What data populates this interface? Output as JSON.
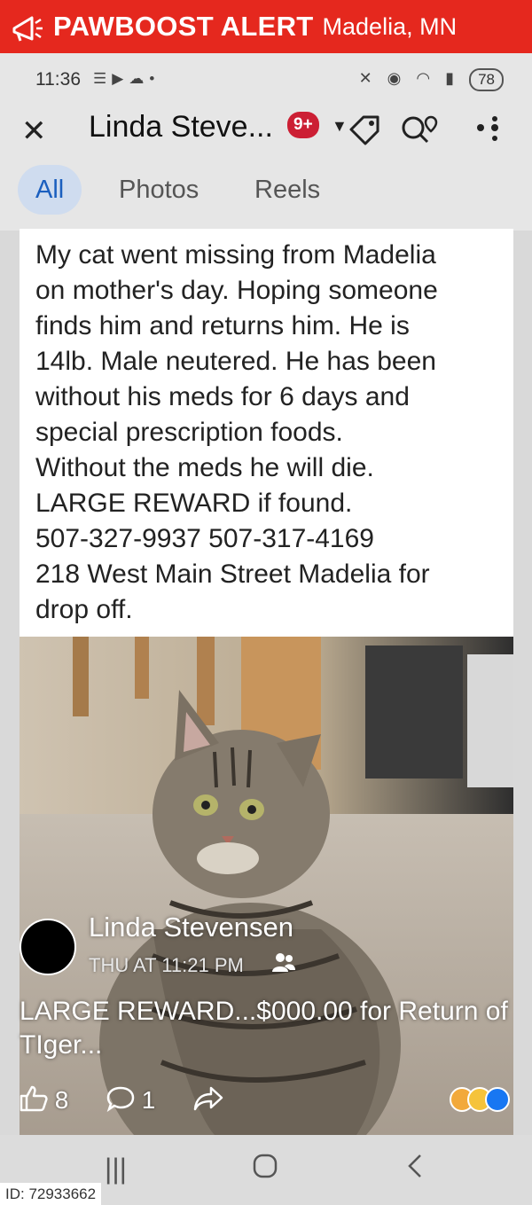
{
  "banner": {
    "brand": "PAWBOOST ALERT",
    "location": "Madelia, MN",
    "color": "#e5281e"
  },
  "status_bar": {
    "time": "11:36",
    "battery": "78"
  },
  "header": {
    "title": "Linda Steve...",
    "badge": "9+"
  },
  "tabs": [
    {
      "label": "All",
      "active": true
    },
    {
      "label": "Photos",
      "active": false
    },
    {
      "label": "Reels",
      "active": false
    }
  ],
  "post": {
    "text": "My cat went missing from Madelia\non mother's day. Hoping someone\nfinds him and returns him.  He is\n14lb. Male neutered. He has been\nwithout his meds for 6 days and\nspecial prescription foods.\nWithout the meds he will die.\nLARGE REWARD if found.\n507-327-9937 507-317-4169\n218 West Main Street Madelia for\ndrop off.",
    "poster_name": "Linda Stevensen",
    "poster_time": "THU AT 11:21 PM",
    "caption": "LARGE REWARD...$000.00 for Return of TIger...",
    "likes": "8",
    "comments": "1"
  },
  "footer": {
    "id_label": "ID: 72933662"
  }
}
